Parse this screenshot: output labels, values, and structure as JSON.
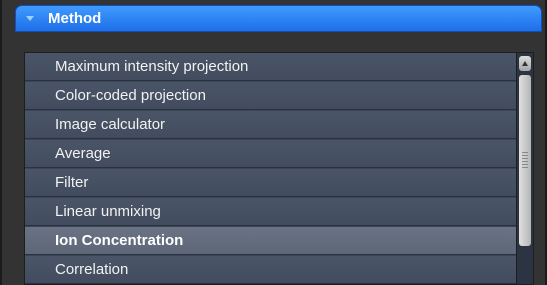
{
  "panel": {
    "title": "Method",
    "toggle_icon": "triangle-down-icon",
    "accent_color": "#2a80f5"
  },
  "method_list": {
    "items": [
      {
        "label": "Maximum intensity projection",
        "selected": false
      },
      {
        "label": "Color-coded projection",
        "selected": false
      },
      {
        "label": "Image calculator",
        "selected": false
      },
      {
        "label": "Average",
        "selected": false
      },
      {
        "label": "Filter",
        "selected": false
      },
      {
        "label": "Linear unmixing",
        "selected": false
      },
      {
        "label": "Ion Concentration",
        "selected": true
      },
      {
        "label": "Correlation",
        "selected": false
      }
    ],
    "scroll_up_icon": "scroll-up-arrow-icon"
  }
}
